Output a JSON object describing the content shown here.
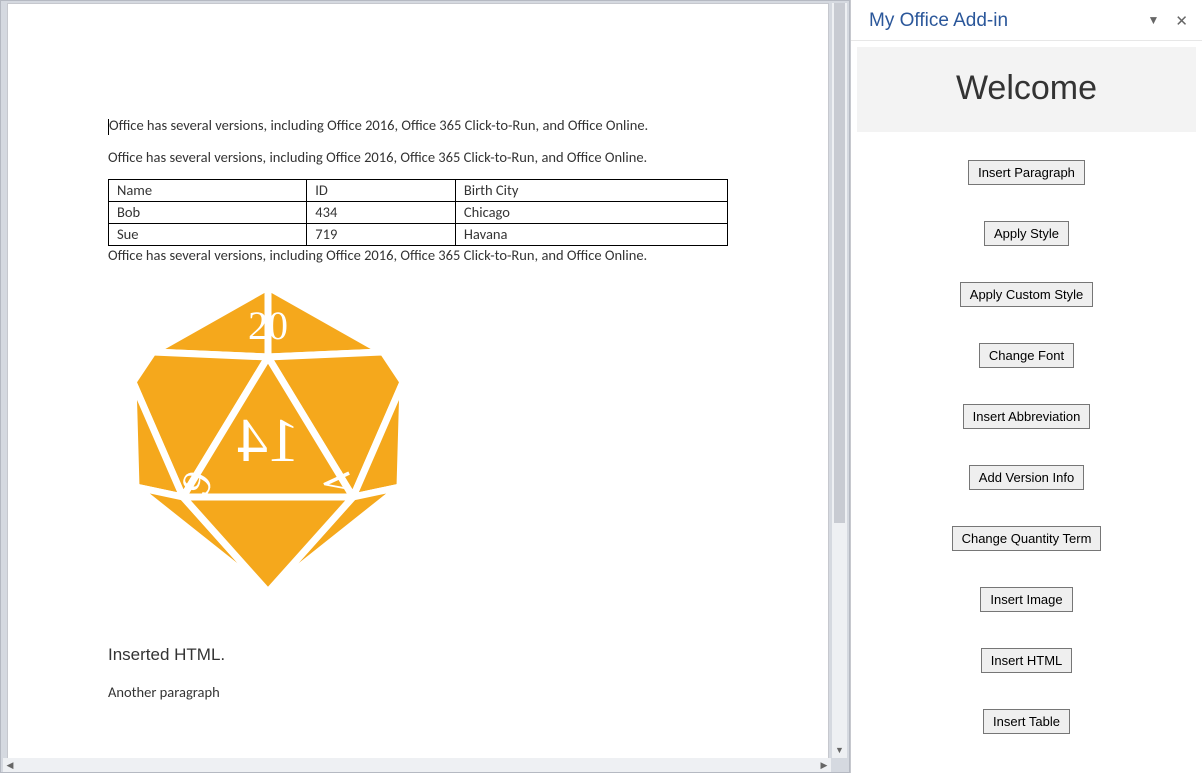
{
  "document": {
    "para1": "Office has several versions, including Office 2016, Office 365 Click-to-Run, and Office Online.",
    "para2": "Office has several versions, including Office 2016, Office 365 Click-to-Run, and Office Online.",
    "para3": "Office has several versions, including Office 2016, Office 365 Click-to-Run, and Office Online.",
    "table": {
      "rows": [
        {
          "c0": "Name",
          "c1": "ID",
          "c2": "Birth City"
        },
        {
          "c0": "Bob",
          "c1": "434",
          "c2": "Chicago"
        },
        {
          "c0": "Sue",
          "c1": "719",
          "c2": "Havana"
        }
      ]
    },
    "inserted_html_heading": "Inserted HTML.",
    "another_paragraph": "Another paragraph",
    "dice": {
      "top_number": "20",
      "center_number": "14",
      "left_number": "6",
      "right_number": "4",
      "color": "#f5a81c"
    }
  },
  "taskpane": {
    "title": "My Office Add-in",
    "welcome": "Welcome",
    "buttons": {
      "insert_paragraph": "Insert Paragraph",
      "apply_style": "Apply Style",
      "apply_custom_style": "Apply Custom Style",
      "change_font": "Change Font",
      "insert_abbreviation": "Insert Abbreviation",
      "add_version_info": "Add Version Info",
      "change_quantity_term": "Change Quantity Term",
      "insert_image": "Insert Image",
      "insert_html": "Insert HTML",
      "insert_table": "Insert Table"
    }
  }
}
